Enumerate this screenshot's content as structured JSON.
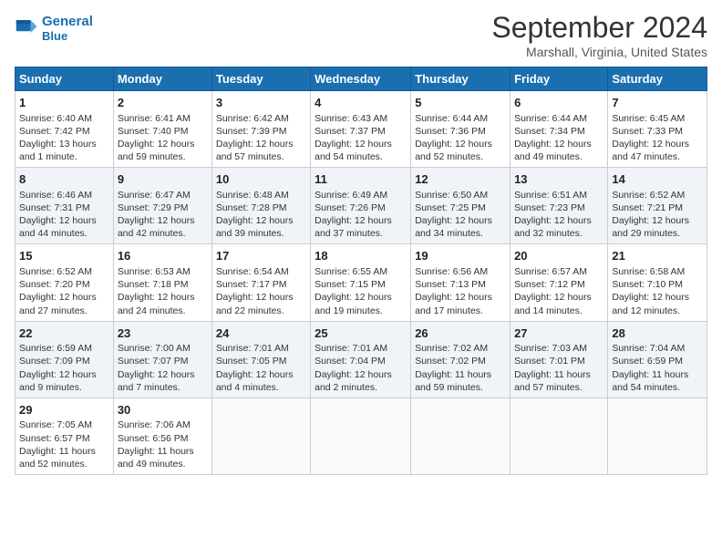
{
  "header": {
    "logo_line1": "General",
    "logo_line2": "Blue",
    "month": "September 2024",
    "location": "Marshall, Virginia, United States"
  },
  "weekdays": [
    "Sunday",
    "Monday",
    "Tuesday",
    "Wednesday",
    "Thursday",
    "Friday",
    "Saturday"
  ],
  "weeks": [
    [
      {
        "day": "1",
        "info": "Sunrise: 6:40 AM\nSunset: 7:42 PM\nDaylight: 13 hours\nand 1 minute."
      },
      {
        "day": "2",
        "info": "Sunrise: 6:41 AM\nSunset: 7:40 PM\nDaylight: 12 hours\nand 59 minutes."
      },
      {
        "day": "3",
        "info": "Sunrise: 6:42 AM\nSunset: 7:39 PM\nDaylight: 12 hours\nand 57 minutes."
      },
      {
        "day": "4",
        "info": "Sunrise: 6:43 AM\nSunset: 7:37 PM\nDaylight: 12 hours\nand 54 minutes."
      },
      {
        "day": "5",
        "info": "Sunrise: 6:44 AM\nSunset: 7:36 PM\nDaylight: 12 hours\nand 52 minutes."
      },
      {
        "day": "6",
        "info": "Sunrise: 6:44 AM\nSunset: 7:34 PM\nDaylight: 12 hours\nand 49 minutes."
      },
      {
        "day": "7",
        "info": "Sunrise: 6:45 AM\nSunset: 7:33 PM\nDaylight: 12 hours\nand 47 minutes."
      }
    ],
    [
      {
        "day": "8",
        "info": "Sunrise: 6:46 AM\nSunset: 7:31 PM\nDaylight: 12 hours\nand 44 minutes."
      },
      {
        "day": "9",
        "info": "Sunrise: 6:47 AM\nSunset: 7:29 PM\nDaylight: 12 hours\nand 42 minutes."
      },
      {
        "day": "10",
        "info": "Sunrise: 6:48 AM\nSunset: 7:28 PM\nDaylight: 12 hours\nand 39 minutes."
      },
      {
        "day": "11",
        "info": "Sunrise: 6:49 AM\nSunset: 7:26 PM\nDaylight: 12 hours\nand 37 minutes."
      },
      {
        "day": "12",
        "info": "Sunrise: 6:50 AM\nSunset: 7:25 PM\nDaylight: 12 hours\nand 34 minutes."
      },
      {
        "day": "13",
        "info": "Sunrise: 6:51 AM\nSunset: 7:23 PM\nDaylight: 12 hours\nand 32 minutes."
      },
      {
        "day": "14",
        "info": "Sunrise: 6:52 AM\nSunset: 7:21 PM\nDaylight: 12 hours\nand 29 minutes."
      }
    ],
    [
      {
        "day": "15",
        "info": "Sunrise: 6:52 AM\nSunset: 7:20 PM\nDaylight: 12 hours\nand 27 minutes."
      },
      {
        "day": "16",
        "info": "Sunrise: 6:53 AM\nSunset: 7:18 PM\nDaylight: 12 hours\nand 24 minutes."
      },
      {
        "day": "17",
        "info": "Sunrise: 6:54 AM\nSunset: 7:17 PM\nDaylight: 12 hours\nand 22 minutes."
      },
      {
        "day": "18",
        "info": "Sunrise: 6:55 AM\nSunset: 7:15 PM\nDaylight: 12 hours\nand 19 minutes."
      },
      {
        "day": "19",
        "info": "Sunrise: 6:56 AM\nSunset: 7:13 PM\nDaylight: 12 hours\nand 17 minutes."
      },
      {
        "day": "20",
        "info": "Sunrise: 6:57 AM\nSunset: 7:12 PM\nDaylight: 12 hours\nand 14 minutes."
      },
      {
        "day": "21",
        "info": "Sunrise: 6:58 AM\nSunset: 7:10 PM\nDaylight: 12 hours\nand 12 minutes."
      }
    ],
    [
      {
        "day": "22",
        "info": "Sunrise: 6:59 AM\nSunset: 7:09 PM\nDaylight: 12 hours\nand 9 minutes."
      },
      {
        "day": "23",
        "info": "Sunrise: 7:00 AM\nSunset: 7:07 PM\nDaylight: 12 hours\nand 7 minutes."
      },
      {
        "day": "24",
        "info": "Sunrise: 7:01 AM\nSunset: 7:05 PM\nDaylight: 12 hours\nand 4 minutes."
      },
      {
        "day": "25",
        "info": "Sunrise: 7:01 AM\nSunset: 7:04 PM\nDaylight: 12 hours\nand 2 minutes."
      },
      {
        "day": "26",
        "info": "Sunrise: 7:02 AM\nSunset: 7:02 PM\nDaylight: 11 hours\nand 59 minutes."
      },
      {
        "day": "27",
        "info": "Sunrise: 7:03 AM\nSunset: 7:01 PM\nDaylight: 11 hours\nand 57 minutes."
      },
      {
        "day": "28",
        "info": "Sunrise: 7:04 AM\nSunset: 6:59 PM\nDaylight: 11 hours\nand 54 minutes."
      }
    ],
    [
      {
        "day": "29",
        "info": "Sunrise: 7:05 AM\nSunset: 6:57 PM\nDaylight: 11 hours\nand 52 minutes."
      },
      {
        "day": "30",
        "info": "Sunrise: 7:06 AM\nSunset: 6:56 PM\nDaylight: 11 hours\nand 49 minutes."
      },
      null,
      null,
      null,
      null,
      null
    ]
  ]
}
